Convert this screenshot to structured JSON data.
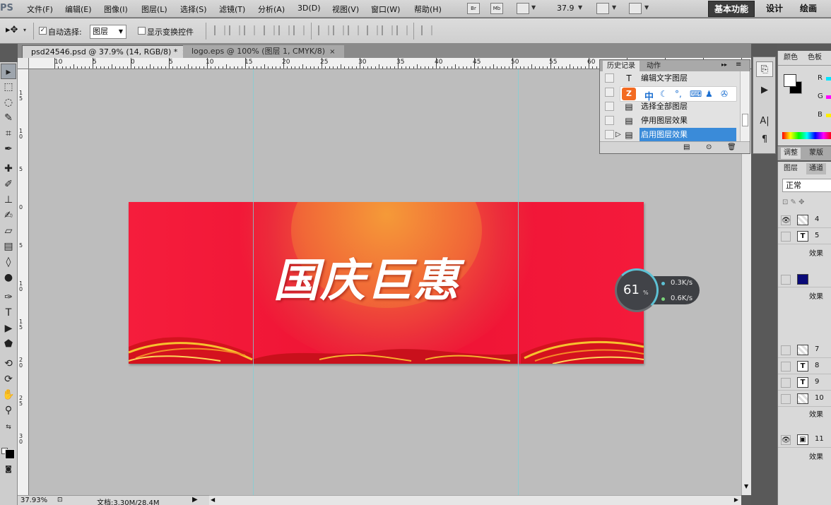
{
  "app": {
    "logo_text": "PS"
  },
  "menu": {
    "items": [
      "文件(F)",
      "编辑(E)",
      "图像(I)",
      "图层(L)",
      "选择(S)",
      "滤镜(T)",
      "分析(A)",
      "3D(D)",
      "视图(V)",
      "窗口(W)",
      "帮助(H)"
    ],
    "icon_br": "Br",
    "icon_mb": "Mb",
    "zoom": "37.9",
    "workspaces": [
      "基本功能",
      "设计",
      "绘画"
    ]
  },
  "options": {
    "auto_select_label": "自动选择:",
    "auto_select_checked": true,
    "auto_select_target": "图层",
    "show_transform_label": "显示变换控件"
  },
  "tabs": [
    {
      "label": "psd24546.psd @ 37.9% (14, RGB/8) *",
      "close": "×"
    },
    {
      "label": "logo.eps @ 100% (图层 1, CMYK/8)",
      "close": "×"
    }
  ],
  "ruler": {
    "h_labels": [
      "10",
      "5",
      "0",
      "5",
      "10",
      "15",
      "20",
      "25",
      "30",
      "35",
      "40",
      "45",
      "50",
      "55",
      "60"
    ],
    "v_labels": [
      "1 5",
      "1 0",
      "5",
      "0",
      "5",
      "1 0",
      "1 5",
      "2 0",
      "2 5",
      "3 0"
    ]
  },
  "artboard": {
    "headline": "国庆巨惠",
    "colors": {
      "base": "#ef1535",
      "glow": "#f47a36",
      "flame": "#f7c12e"
    }
  },
  "net_widget": {
    "percent": "61",
    "percent_sign": "%",
    "upload": "0.3K/s",
    "download": "0.6K/s"
  },
  "status": {
    "zoom": "37.93%",
    "doc": "文档:3.30M/28.4M",
    "arrow": "▶"
  },
  "history": {
    "tabs": [
      "历史记录",
      "动作"
    ],
    "rows": [
      {
        "icon": "T",
        "label": "编辑文字图层"
      },
      {
        "icon": "▤",
        "label": "选择全部图层"
      },
      {
        "icon": "▤",
        "label": "停用图层效果"
      },
      {
        "icon": "▤",
        "label": "启用图层效果"
      }
    ],
    "selected_index": 3,
    "ime": {
      "logo": "Z",
      "mode": "中"
    }
  },
  "right_panels": {
    "color_tabs": [
      "颜色",
      "色板"
    ],
    "rgb_labels": [
      "R",
      "G",
      "B"
    ],
    "adj_tabs": [
      "调整",
      "蒙版"
    ],
    "layer_tabs": [
      "图层",
      "通道"
    ],
    "blend_mode": "正常",
    "layers": [
      {
        "name": "4",
        "thumb": "▦"
      },
      {
        "name": "5",
        "thumb": "T"
      },
      {
        "name": "效果",
        "thumb": ""
      },
      {
        "name": "",
        "thumb": "■"
      },
      {
        "name": "效果",
        "thumb": ""
      },
      {
        "name": "7",
        "thumb": "▦"
      },
      {
        "name": "8",
        "thumb": "T"
      },
      {
        "name": "9",
        "thumb": "T"
      },
      {
        "name": "10",
        "thumb": "▦"
      },
      {
        "name": "效果",
        "thumb": ""
      },
      {
        "name": "11",
        "thumb": "▣"
      },
      {
        "name": "效果",
        "thumb": ""
      }
    ]
  },
  "side_icons": [
    "history-brush",
    "play",
    "character",
    "paragraph"
  ]
}
